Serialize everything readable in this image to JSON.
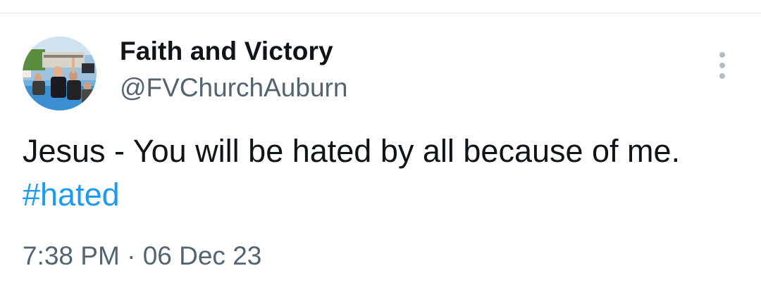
{
  "tweet": {
    "display_name": "Faith and Victory",
    "handle": "@FVChurchAuburn",
    "text_before": "Jesus - You will be hated by all because of me.",
    "hashtag": "#hated",
    "time": "7:38 PM",
    "separator": "·",
    "date": "06 Dec 23"
  },
  "icons": {
    "more": "more-vertical-icon"
  },
  "colors": {
    "primary_text": "#0f1419",
    "secondary_text": "#536471",
    "link": "#1d9bf0",
    "divider": "#e6e9ec"
  }
}
